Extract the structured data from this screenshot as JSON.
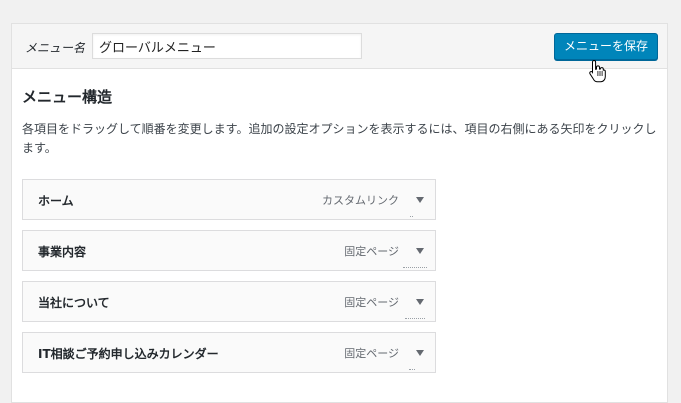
{
  "header": {
    "menu_name_label": "メニュー名",
    "menu_name_value": "グローバルメニュー",
    "save_label": "メニューを保存"
  },
  "structure": {
    "title": "メニュー構造",
    "description": "各項目をドラッグして順番を変更します。追加の設定オプションを表示するには、項目の右側にある矢印をクリックします。"
  },
  "menu_items": [
    {
      "title": "ホーム",
      "type": "カスタムリンク"
    },
    {
      "title": "事業内容",
      "type": "固定ページ"
    },
    {
      "title": "当社について",
      "type": "固定ページ"
    },
    {
      "title": "IT相談ご予約申し込みカレンダー",
      "type": "固定ページ"
    }
  ],
  "colors": {
    "accent": "#0085ba",
    "panel_bg": "#ffffff",
    "page_bg": "#f1f1f1"
  },
  "icons": {
    "cursor": "hand-pointer-icon",
    "toggle": "triangle-down-icon"
  }
}
